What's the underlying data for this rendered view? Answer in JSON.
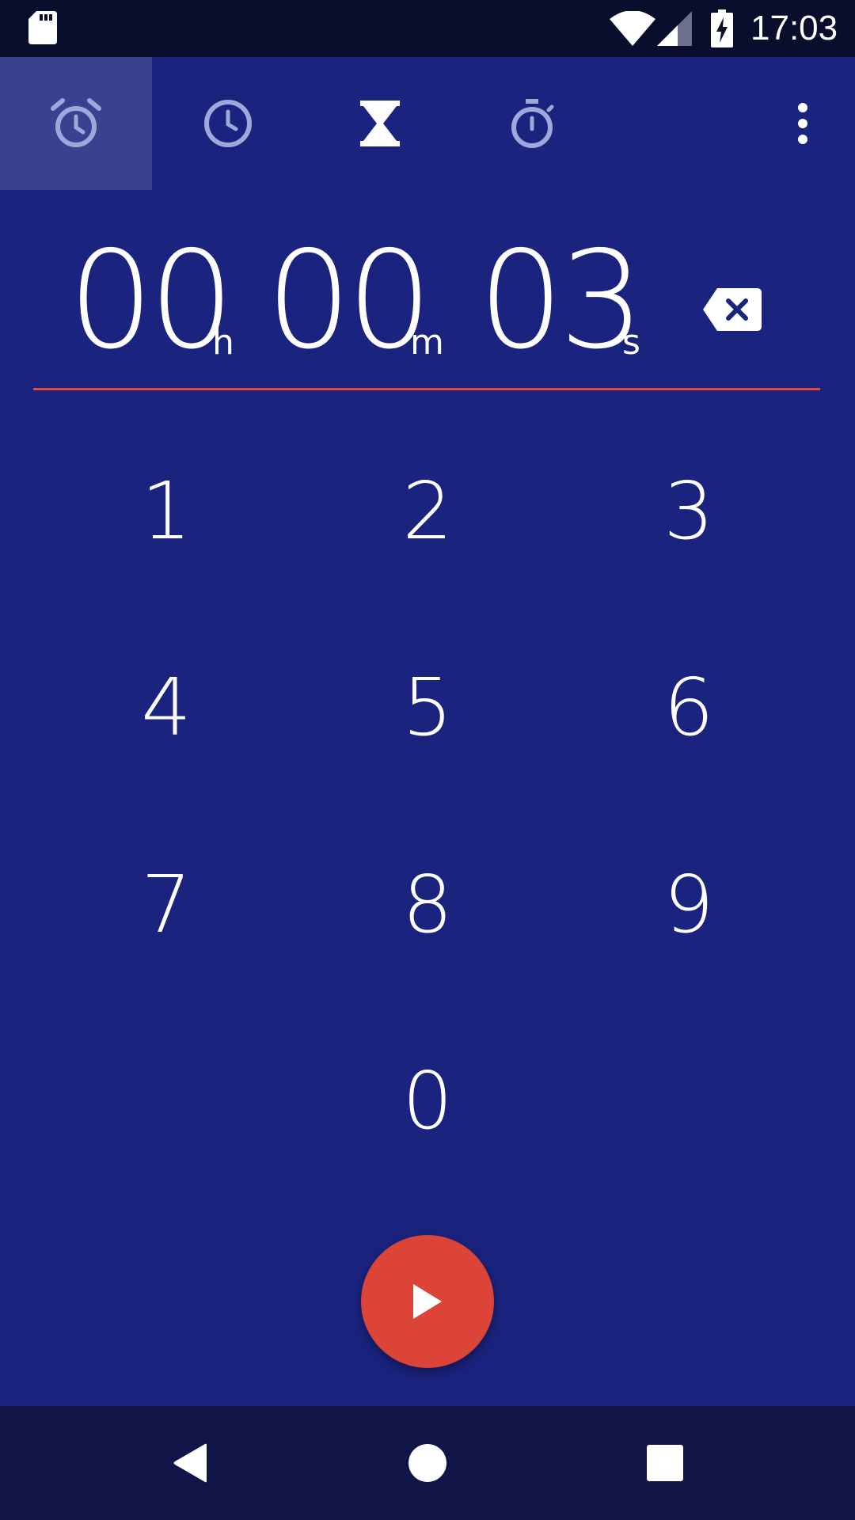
{
  "status_bar": {
    "time": "17:03",
    "icons": [
      "sd-card-icon",
      "wifi-icon",
      "signal-icon",
      "battery-charging-icon"
    ]
  },
  "tabs": [
    {
      "name": "alarm",
      "icon": "alarm-icon",
      "active": true
    },
    {
      "name": "clock",
      "icon": "clock-icon",
      "active": false
    },
    {
      "name": "timer",
      "icon": "hourglass-icon",
      "active": false
    },
    {
      "name": "stopwatch",
      "icon": "stopwatch-icon",
      "active": false
    }
  ],
  "timer": {
    "hours": "00",
    "hours_unit": "h",
    "minutes": "00",
    "minutes_unit": "m",
    "seconds": "03",
    "seconds_unit": "s"
  },
  "keypad": {
    "k1": "1",
    "k2": "2",
    "k3": "3",
    "k4": "4",
    "k5": "5",
    "k6": "6",
    "k7": "7",
    "k8": "8",
    "k9": "9",
    "k0": "0"
  },
  "colors": {
    "background": "#1a237e",
    "status_bar": "#0a0e2d",
    "nav_bar": "#101446",
    "accent": "#db4437",
    "divider": "#e04e45"
  }
}
